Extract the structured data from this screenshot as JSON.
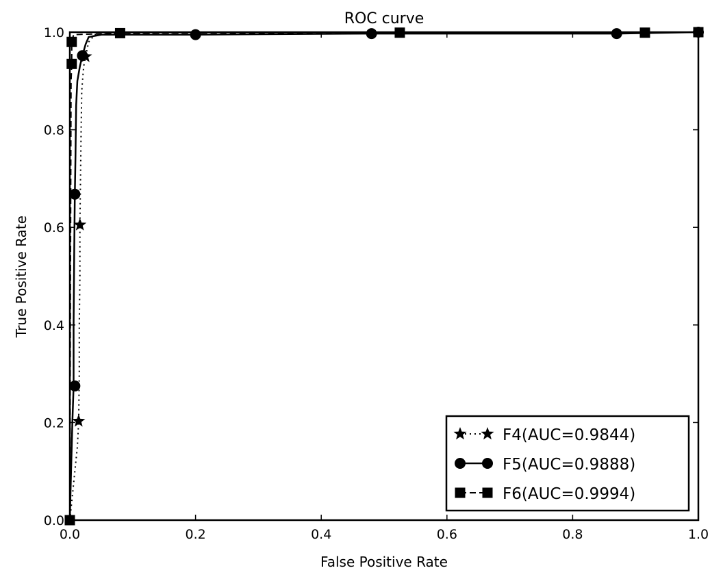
{
  "chart_data": {
    "type": "line",
    "title": "ROC curve",
    "xlabel": "False Positive Rate",
    "ylabel": "True Positive Rate",
    "xlim": [
      0.0,
      1.0
    ],
    "ylim": [
      0.0,
      1.0
    ],
    "xticks": [
      "0.0",
      "0.2",
      "0.4",
      "0.6",
      "0.8",
      "1.0"
    ],
    "yticks": [
      "0.0",
      "0.2",
      "0.4",
      "0.6",
      "0.8",
      "1.0"
    ],
    "grid": false,
    "legend_position": "bottom-right",
    "series": [
      {
        "name": "F4(AUC=0.9844)",
        "linestyle": "dotted",
        "marker": "star",
        "color": "#000000",
        "points": [
          [
            0.0,
            0.0
          ],
          [
            0.004,
            0.05
          ],
          [
            0.008,
            0.1
          ],
          [
            0.012,
            0.15
          ],
          [
            0.014,
            0.203
          ],
          [
            0.015,
            0.3
          ],
          [
            0.015,
            0.4
          ],
          [
            0.016,
            0.5
          ],
          [
            0.016,
            0.605
          ],
          [
            0.017,
            0.7
          ],
          [
            0.018,
            0.8
          ],
          [
            0.019,
            0.88
          ],
          [
            0.022,
            0.93
          ],
          [
            0.025,
            0.95
          ],
          [
            0.03,
            0.98
          ],
          [
            0.04,
            0.995
          ],
          [
            0.08,
            0.998
          ],
          [
            0.3,
            1.0
          ],
          [
            1.0,
            1.0
          ]
        ],
        "marker_points": [
          [
            0.014,
            0.203
          ],
          [
            0.016,
            0.605
          ],
          [
            0.025,
            0.95
          ]
        ]
      },
      {
        "name": "F5(AUC=0.9888)",
        "linestyle": "solid",
        "marker": "circle",
        "color": "#000000",
        "points": [
          [
            0.0,
            0.0
          ],
          [
            0.002,
            0.1
          ],
          [
            0.004,
            0.2
          ],
          [
            0.006,
            0.275
          ],
          [
            0.006,
            0.4
          ],
          [
            0.007,
            0.55
          ],
          [
            0.008,
            0.668
          ],
          [
            0.009,
            0.75
          ],
          [
            0.01,
            0.85
          ],
          [
            0.012,
            0.9
          ],
          [
            0.016,
            0.93
          ],
          [
            0.02,
            0.952
          ],
          [
            0.025,
            0.975
          ],
          [
            0.03,
            0.99
          ],
          [
            0.05,
            0.995
          ],
          [
            0.2,
            0.995
          ],
          [
            0.48,
            0.997
          ],
          [
            0.87,
            0.997
          ],
          [
            1.0,
            1.0
          ]
        ],
        "marker_points": [
          [
            0.008,
            0.275
          ],
          [
            0.008,
            0.668
          ],
          [
            0.02,
            0.952
          ],
          [
            0.2,
            0.995
          ],
          [
            0.48,
            0.997
          ],
          [
            0.87,
            0.997
          ],
          [
            1.0,
            1.0
          ]
        ]
      },
      {
        "name": "F6(AUC=0.9994)",
        "linestyle": "dashed",
        "marker": "square",
        "color": "#000000",
        "points": [
          [
            0.0,
            0.0
          ],
          [
            0.001,
            0.5
          ],
          [
            0.002,
            0.9
          ],
          [
            0.003,
            0.935
          ],
          [
            0.003,
            0.98
          ],
          [
            0.006,
            0.995
          ],
          [
            0.08,
            0.998
          ],
          [
            0.525,
            0.999
          ],
          [
            0.915,
            0.999
          ],
          [
            1.0,
            1.0
          ]
        ],
        "marker_points": [
          [
            0.0,
            0.0
          ],
          [
            0.003,
            0.935
          ],
          [
            0.003,
            0.98
          ],
          [
            0.08,
            0.998
          ],
          [
            0.525,
            0.999
          ],
          [
            0.915,
            0.999
          ],
          [
            1.0,
            1.0
          ]
        ]
      }
    ]
  }
}
